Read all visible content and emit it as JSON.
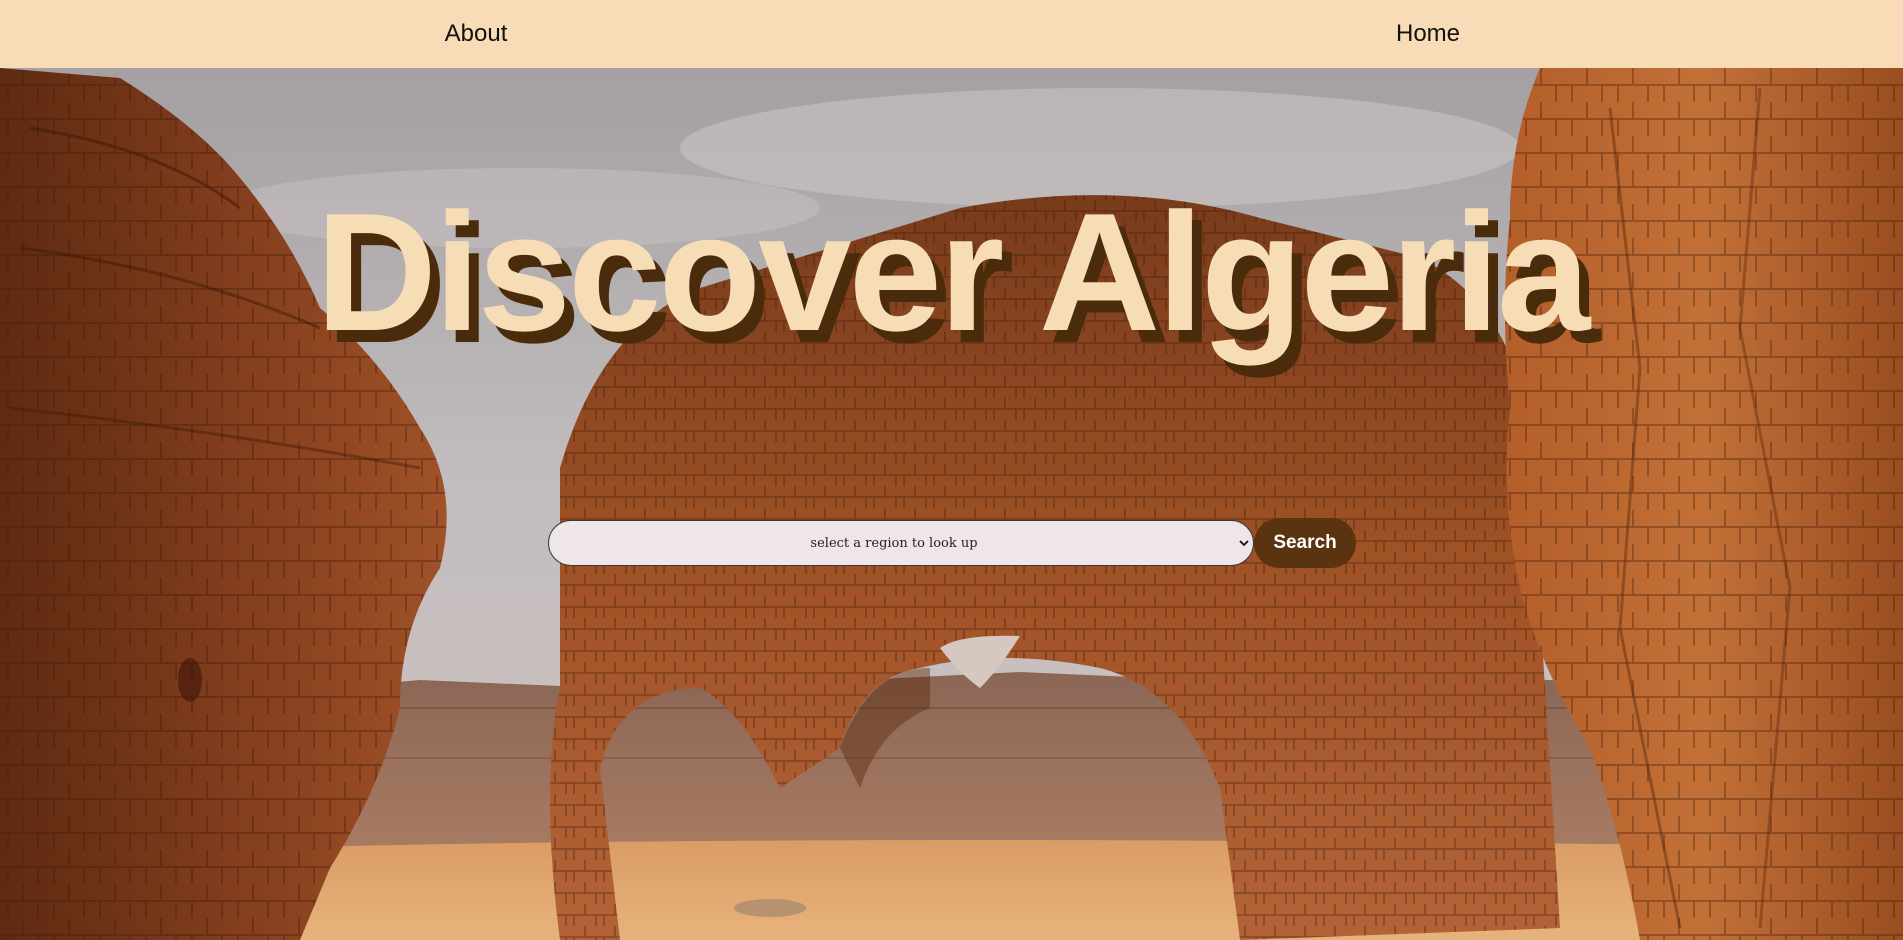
{
  "nav": {
    "about_label": "About",
    "home_label": "Home"
  },
  "hero": {
    "title": "Discover Algeria",
    "background_image": "desert-rock-arch-photo"
  },
  "search": {
    "select_value": "select a region to look up",
    "button_label": "Search"
  },
  "colors": {
    "navbar_bg": "#f7dcb7",
    "title_color": "#f6ddb6",
    "title_shadow": "#4a2b0c",
    "button_bg": "#5a3410",
    "select_bg": "#efe6e8"
  }
}
